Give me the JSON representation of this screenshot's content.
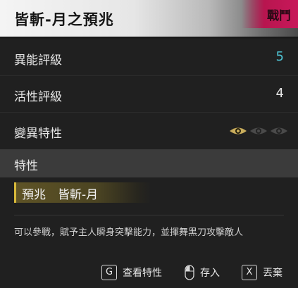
{
  "header": {
    "title": "皆斬-月之預兆",
    "badge": "戰鬥",
    "accent_color": "#c8185a"
  },
  "rows": [
    {
      "label": "異能評級",
      "value": "5",
      "value_color": "#4fc6d6"
    },
    {
      "label": "活性評級",
      "value": "4"
    },
    {
      "label": "變異特性",
      "icons": [
        "eye-icon",
        "eye-icon",
        "eye-icon"
      ],
      "active_count": 1
    }
  ],
  "traits": {
    "title": "特性",
    "chip": "預兆　皆斬-月",
    "chip_accent": "#d8b93a"
  },
  "description": "可以參戰，賦予主人瞬身突擊能力，並揮舞黑刀攻擊敵人",
  "footer": {
    "hints": [
      {
        "key": "G",
        "label": "查看特性"
      },
      {
        "key": "mouse-icon",
        "label": "存入"
      },
      {
        "key": "X",
        "label": "丟棄"
      }
    ]
  }
}
